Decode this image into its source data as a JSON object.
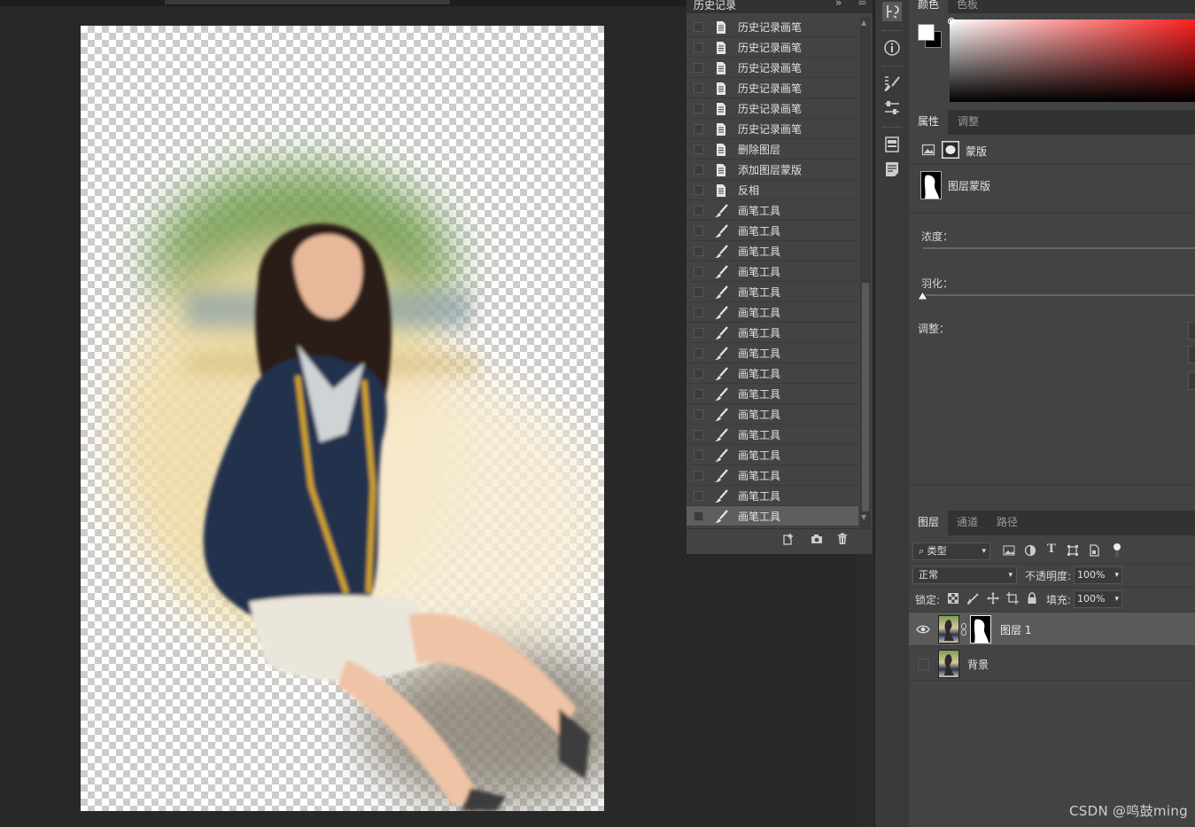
{
  "history": {
    "title": "历史记录",
    "items": [
      {
        "label": "历史记录画笔",
        "icon": "document-icon",
        "selected": false
      },
      {
        "label": "历史记录画笔",
        "icon": "document-icon",
        "selected": false
      },
      {
        "label": "历史记录画笔",
        "icon": "document-icon",
        "selected": false
      },
      {
        "label": "历史记录画笔",
        "icon": "document-icon",
        "selected": false
      },
      {
        "label": "历史记录画笔",
        "icon": "document-icon",
        "selected": false
      },
      {
        "label": "历史记录画笔",
        "icon": "document-icon",
        "selected": false
      },
      {
        "label": "删除图层",
        "icon": "document-icon",
        "selected": false
      },
      {
        "label": "添加图层蒙版",
        "icon": "document-icon",
        "selected": false
      },
      {
        "label": "反相",
        "icon": "document-icon",
        "selected": false
      },
      {
        "label": "画笔工具",
        "icon": "brush-icon",
        "selected": false
      },
      {
        "label": "画笔工具",
        "icon": "brush-icon",
        "selected": false
      },
      {
        "label": "画笔工具",
        "icon": "brush-icon",
        "selected": false
      },
      {
        "label": "画笔工具",
        "icon": "brush-icon",
        "selected": false
      },
      {
        "label": "画笔工具",
        "icon": "brush-icon",
        "selected": false
      },
      {
        "label": "画笔工具",
        "icon": "brush-icon",
        "selected": false
      },
      {
        "label": "画笔工具",
        "icon": "brush-icon",
        "selected": false
      },
      {
        "label": "画笔工具",
        "icon": "brush-icon",
        "selected": false
      },
      {
        "label": "画笔工具",
        "icon": "brush-icon",
        "selected": false
      },
      {
        "label": "画笔工具",
        "icon": "brush-icon",
        "selected": false
      },
      {
        "label": "画笔工具",
        "icon": "brush-icon",
        "selected": false
      },
      {
        "label": "画笔工具",
        "icon": "brush-icon",
        "selected": false
      },
      {
        "label": "画笔工具",
        "icon": "brush-icon",
        "selected": false
      },
      {
        "label": "画笔工具",
        "icon": "brush-icon",
        "selected": false
      },
      {
        "label": "画笔工具",
        "icon": "brush-icon",
        "selected": false
      },
      {
        "label": "画笔工具",
        "icon": "brush-icon",
        "selected": true
      }
    ]
  },
  "color_panel": {
    "tabs": [
      "颜色",
      "色板"
    ],
    "foreground": "#ffffff",
    "background": "#000000"
  },
  "properties": {
    "tabs": [
      "属性",
      "调整"
    ],
    "mask_label": "蒙版",
    "layer_mask_label": "图层蒙版",
    "density_label": "浓度：",
    "feather_label": "羽化：",
    "adjust_label": "调整："
  },
  "layers": {
    "tabs": [
      "图层",
      "通道",
      "路径"
    ],
    "filter_kind": "类型",
    "blend_mode": "正常",
    "opacity_label": "不透明度:",
    "opacity_value": "100%",
    "lock_label": "锁定:",
    "fill_label": "填充:",
    "fill_value": "100%",
    "items": [
      {
        "name": "图层 1",
        "visible": true,
        "has_mask": true,
        "selected": true
      },
      {
        "name": "背景",
        "visible": false,
        "has_mask": false,
        "selected": false
      }
    ]
  },
  "watermark": "CSDN @鸣鼓ming"
}
